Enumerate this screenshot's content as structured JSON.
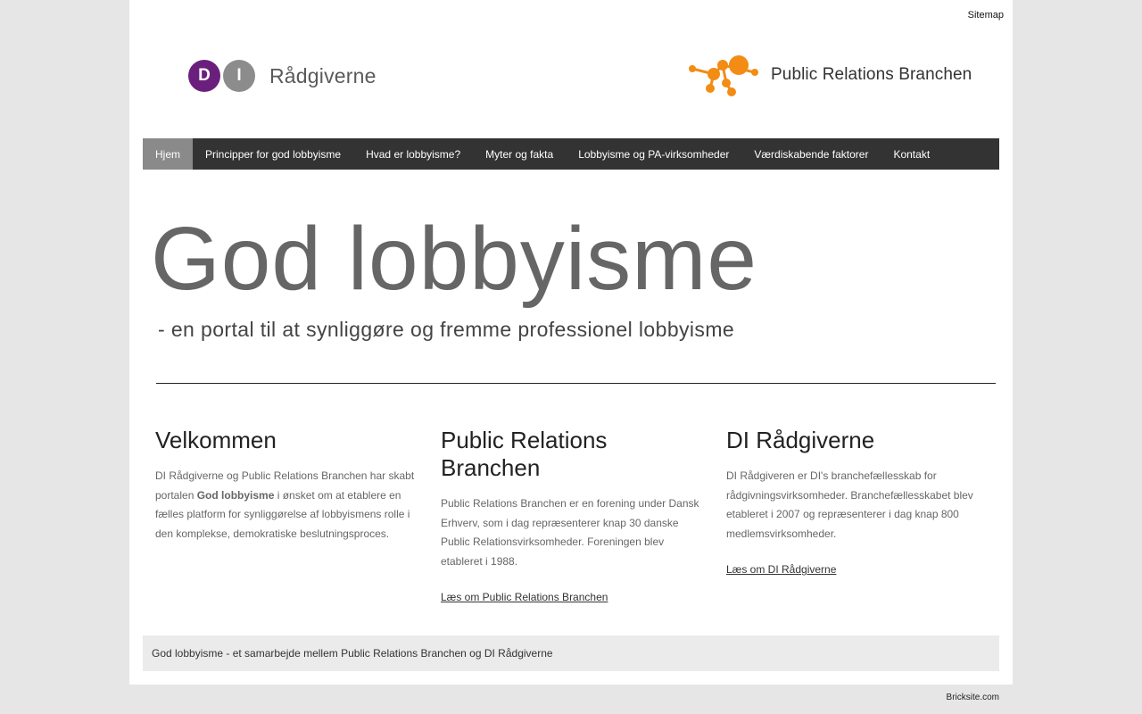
{
  "header": {
    "sitemap_label": "Sitemap",
    "di_logo": {
      "letter1": "D",
      "letter2": "I",
      "name": "Rådgiverne"
    },
    "pr_logo": {
      "name": "Public Relations Branchen"
    }
  },
  "nav": {
    "items": [
      {
        "label": "Hjem"
      },
      {
        "label": "Principper for god lobbyisme"
      },
      {
        "label": "Hvad er lobbyisme?"
      },
      {
        "label": "Myter og fakta"
      },
      {
        "label": "Lobbyisme og PA-virksomheder"
      },
      {
        "label": "Værdiskabende faktorer"
      },
      {
        "label": "Kontakt"
      }
    ]
  },
  "banner": {
    "title": "God lobbyisme",
    "subtitle": "- en portal til at synliggøre og fremme professionel lobbyisme"
  },
  "columns": {
    "welcome": {
      "heading": "Velkommen",
      "text_before": " DI Rådgiverne og Public Relations Branchen har skabt portalen ",
      "text_bold": "God lobbyisme",
      "text_after": " i ønsket om at etablere en fælles platform for synliggørelse af lobbyismens rolle i den komplekse, demokratiske beslutningsproces."
    },
    "pr": {
      "heading": "Public Relations Branchen",
      "text": "Public Relations Branchen er en forening under Dansk Erhverv, som i dag repræsenterer knap 30 danske Public Relationsvirksomheder. Foreningen blev etableret i 1988.",
      "link": "Læs om Public Relations Branchen"
    },
    "di": {
      "heading": "DI Rådgiverne",
      "text": "DI Rådgiveren er DI's branchefællesskab for rådgivningsvirksomheder. Branchefællesskabet blev etableret i 2007 og repræsenterer i dag knap 800 medlemsvirksomheder.",
      "link": "Læs om DI Rådgiverne"
    }
  },
  "footer": {
    "text": "God lobbyisme - et samarbejde mellem Public Relations Branchen og DI Rådgiverne",
    "bricksite": "Bricksite.com"
  },
  "colors": {
    "di_purple": "#6b1f7c",
    "di_grey": "#8c8c8c",
    "pr_orange": "#f28c14",
    "nav_bg": "#333333",
    "nav_active": "#8a8a8a"
  }
}
